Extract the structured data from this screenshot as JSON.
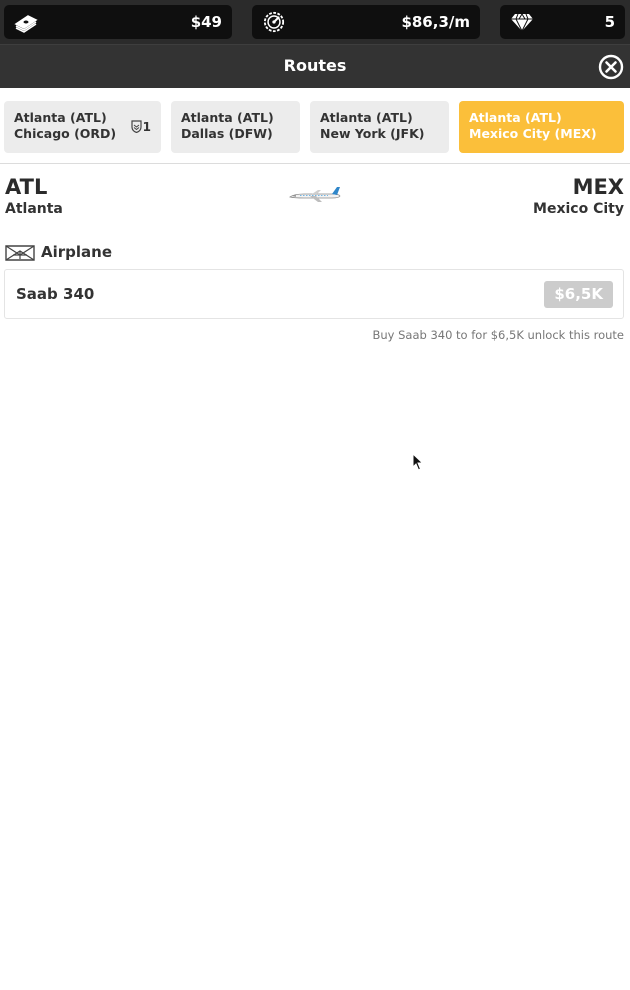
{
  "stats": {
    "cash": {
      "value": "$49",
      "icon": "money-stack-icon"
    },
    "income": {
      "value": "$86,3/m",
      "icon": "speedometer-icon"
    },
    "gems": {
      "value": "5",
      "icon": "diamond-icon"
    }
  },
  "header": {
    "title": "Routes",
    "close_icon": "close-circle-icon"
  },
  "tabs": [
    {
      "line1": "Atlanta (ATL)",
      "line2": "Chicago (ORD)",
      "badge": "1",
      "active": false
    },
    {
      "line1": "Atlanta (ATL)",
      "line2": "Dallas (DFW)",
      "active": false
    },
    {
      "line1": "Atlanta (ATL)",
      "line2": "New York (JFK)",
      "active": false
    },
    {
      "line1": "Atlanta (ATL)",
      "line2": "Mexico City (MEX)",
      "active": true
    }
  ],
  "route": {
    "from": {
      "code": "ATL",
      "city": "Atlanta"
    },
    "to": {
      "code": "MEX",
      "city": "Mexico City"
    }
  },
  "airplane_section": {
    "label": "Airplane",
    "plane_name": "Saab 340",
    "price": "$6,5K",
    "hint": "Buy Saab 340 to for $6,5K unlock this route"
  },
  "colors": {
    "accent": "#fbbf3a",
    "topbar": "#2b2b2b",
    "titlebar": "#333333",
    "price_disabled": "#cccccc"
  }
}
